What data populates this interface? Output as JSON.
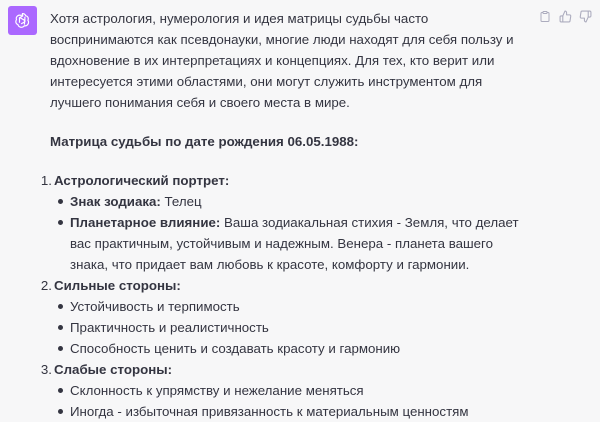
{
  "message": {
    "intro": "Хотя астрология, нумерология и идея матрицы судьбы часто воспринимаются как псевдонауки, многие люди находят для себя пользу и вдохновение в их интерпретациях и концепциях. Для тех, кто верит или интересуется этими областями, они могут служить инструментом для лучшего понимания себя и своего места в мире.",
    "heading": "Матрица судьбы по дате рождения 06.05.1988:",
    "sections": [
      {
        "number": "1.",
        "title": "Астрологический портрет:",
        "items": [
          {
            "label": "Знак зодиака:",
            "text": " Телец"
          },
          {
            "label": "Планетарное влияние:",
            "text": " Ваша зодиакальная стихия - Земля, что делает вас практичным, устойчивым и надежным. Венера - планета вашего знака, что придает вам любовь к красоте, комфорту и гармонии."
          }
        ]
      },
      {
        "number": "2.",
        "title": "Сильные стороны:",
        "items": [
          {
            "label": "",
            "text": "Устойчивость и терпимость"
          },
          {
            "label": "",
            "text": "Практичность и реалистичность"
          },
          {
            "label": "",
            "text": "Способность ценить и создавать красоту и гармонию"
          }
        ]
      },
      {
        "number": "3.",
        "title": "Слабые стороны:",
        "items": [
          {
            "label": "",
            "text": "Склонность к упрямству и нежелание меняться"
          },
          {
            "label": "",
            "text": "Иногда - избыточная привязанность к материальным ценностям"
          }
        ]
      }
    ]
  },
  "icons": {
    "avatar": "openai-logo-icon",
    "copy": "clipboard-icon",
    "like": "thumbs-up-icon",
    "dislike": "thumbs-down-icon"
  },
  "colors": {
    "background": "#f7f7f8",
    "avatar": "#ab68ff",
    "text": "#343541",
    "icon": "#acacbe"
  }
}
